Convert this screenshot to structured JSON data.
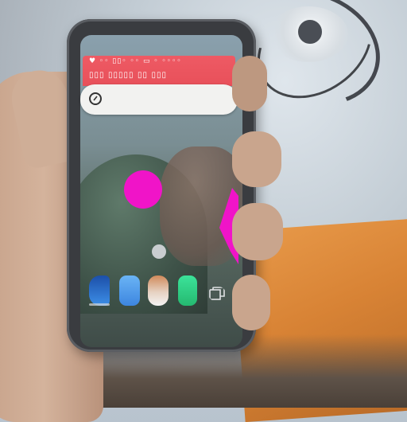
{
  "phone_screen": {
    "status_icons_text": "♥ ◦◦ ▯▯◦ ◦◦ ▭ ◦ ◦◦◦◦",
    "notification_text": "▯▯▯ ▯▯▯▯▯ ▯▯ ▯▯▯",
    "search_bar": {
      "placeholder": ""
    },
    "dock": [
      "phone-app-icon",
      "messages-app-icon",
      "contacts-app-icon",
      "green-app-icon",
      "recent-apps-icon"
    ]
  },
  "colors": {
    "status_bar": "#e8505a",
    "search_bar": "#f2f2f0",
    "magenta_marker": "#f014c8"
  }
}
